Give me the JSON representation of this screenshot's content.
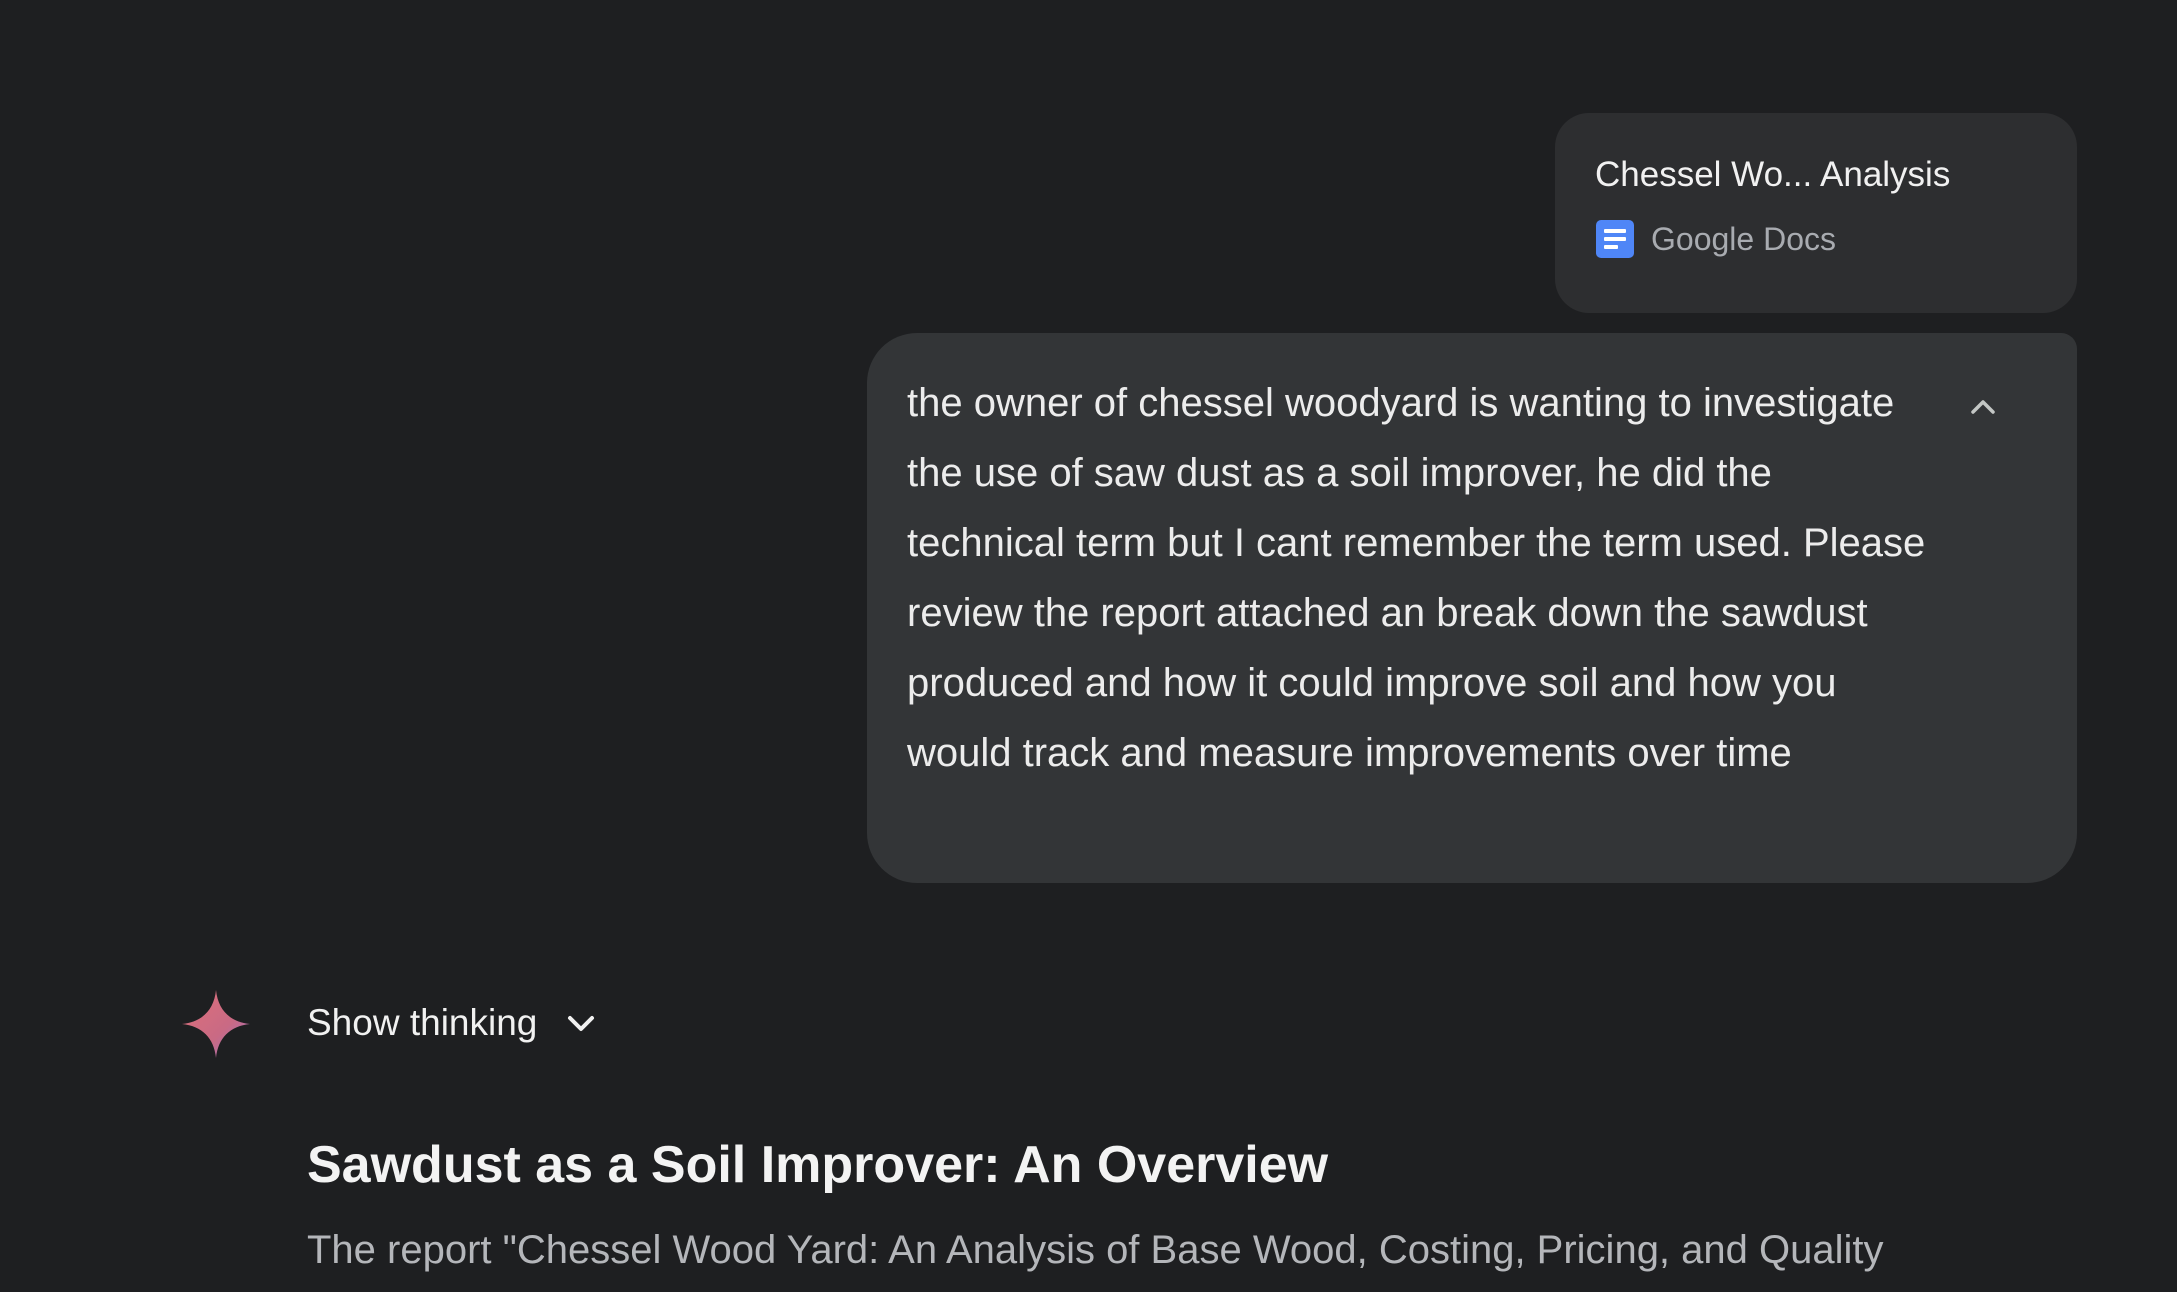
{
  "attachment": {
    "title": "Chessel Wo... Analysis",
    "source": "Google Docs",
    "icon": "google-docs-icon",
    "icon_color": "#4285f4"
  },
  "user_message": {
    "text": "the owner of chessel woodyard is wanting to investigate the use of saw dust as a soil improver, he did the technical term but I cant remember the term used. Please review the report attached an break down the sawdust produced and how it could improve soil and how you would track and measure improvements over time",
    "collapse_icon": "chevron-up-icon"
  },
  "response": {
    "avatar_icon": "gemini-sparkle-icon",
    "show_thinking_label": "Show thinking",
    "show_thinking_icon": "chevron-down-icon",
    "heading": "Sawdust as a Soil Improver: An Overview",
    "paragraph_start": "The report \"Chessel Wood Yard: An Analysis of Base Wood, Costing, Pricing, and Quality"
  },
  "colors": {
    "background": "#1e1f21",
    "card": "#2d2e30",
    "bubble": "#333537",
    "gemini_gradient_start": "#d96570",
    "gemini_gradient_end": "#9b72cb"
  }
}
